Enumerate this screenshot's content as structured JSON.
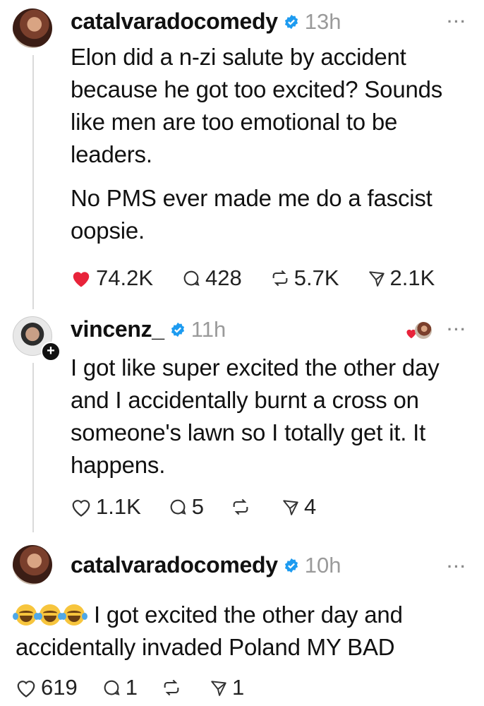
{
  "posts": [
    {
      "username": "catalvaradocomedy",
      "time": "13h",
      "paragraphs": [
        "Elon did a n-zi salute by accident because he got too excited? Sounds like men are too emotional to be leaders.",
        "No PMS ever made me do a fascist oopsie."
      ],
      "likes": "74.2K",
      "comments": "428",
      "reposts": "5.7K",
      "shares": "2.1K",
      "liked": true
    },
    {
      "username": "vincenz_",
      "time": "11h",
      "text": "I got like super excited the other day and I accidentally burnt a cross on someone's lawn so I totally get it. It happens.",
      "likes": "1.1K",
      "comments": "5",
      "reposts": "",
      "shares": "4"
    },
    {
      "username": "catalvaradocomedy",
      "time": "10h",
      "text": "I got excited the other day and accidentally invaded Poland MY BAD",
      "emojis": [
        "face-with-tears-of-joy-icon",
        "face-with-tears-of-joy-icon",
        "face-with-tears-of-joy-icon"
      ],
      "likes": "619",
      "comments": "1",
      "reposts": "",
      "shares": "1"
    }
  ],
  "colors": {
    "liked": "#e8233a",
    "verified": "#1d9bf0",
    "muted": "#9a9a9a"
  }
}
